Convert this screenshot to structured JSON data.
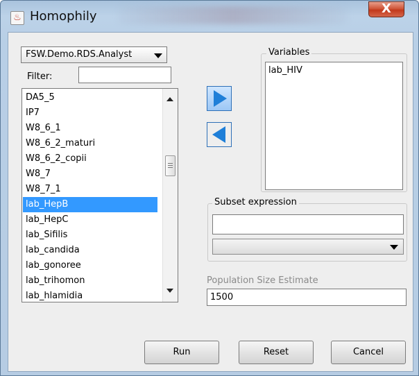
{
  "window": {
    "title": "Homophily",
    "close_label": "X"
  },
  "dataset": {
    "selected": "FSW.Demo.RDS.Analyst"
  },
  "filter": {
    "label": "Filter:",
    "value": ""
  },
  "variable_list": {
    "items": [
      "DA5_5",
      "IP7",
      "W8_6_1",
      "W8_6_2_maturi",
      "W8_6_2_copii",
      "W8_7",
      "W8_7_1",
      "lab_HepB",
      "lab_HepC",
      "lab_Sifilis",
      "lab_candida",
      "lab_gonoree",
      "lab_trihomon",
      "lab_hlamidia"
    ],
    "selected": "lab_HepB"
  },
  "variables": {
    "title": "Variables",
    "items": [
      "lab_HIV"
    ]
  },
  "subset": {
    "title": "Subset expression",
    "value": "",
    "combo_value": ""
  },
  "population": {
    "label": "Population Size Estimate",
    "value": "1500"
  },
  "buttons": {
    "run": "Run",
    "reset": "Reset",
    "cancel": "Cancel"
  },
  "icons": {
    "app": "java-cup-icon",
    "move_right": "arrow-right-icon",
    "move_left": "arrow-left-icon"
  }
}
